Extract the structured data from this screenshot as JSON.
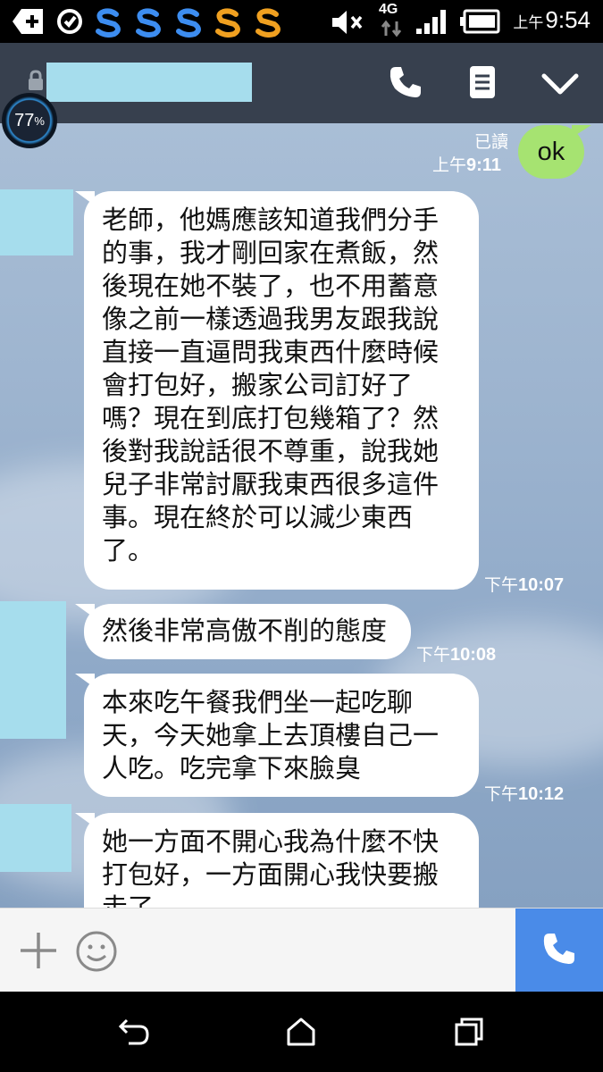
{
  "status_bar": {
    "time_period": "上午",
    "time": "9:54",
    "network_type": "4G",
    "icons": [
      "add-notification-icon",
      "sync-icon",
      "blue-s-app-icon",
      "orange-s-app-icon",
      "mute-icon",
      "signal-icon",
      "battery-icon"
    ]
  },
  "header": {
    "icons": [
      "lock-icon",
      "phone-icon",
      "notes-icon",
      "chevron-down-icon"
    ]
  },
  "battery_widget": {
    "value": "77",
    "unit": "%"
  },
  "sent": {
    "read_label": "已讀",
    "time_period": "上午",
    "time": "9:11",
    "text": "ok"
  },
  "messages": [
    {
      "text": "老師，他媽應該知道我們分手\n的事，我才剛回家在煮飯，然\n後現在她不裝了，也不用蓄意\n像之前一樣透過我男友跟我說\n直接一直逼問我東西什麼時候\n會打包好，搬家公司訂好了\n嗎？現在到底打包幾箱了？然\n後對我說話很不尊重，說我她\n兒子非常討厭我東西很多這件\n事。現在終於可以減少東西\n了。",
      "time_period": "下午",
      "time": "10:07"
    },
    {
      "text": "然後非常高傲不削的態度",
      "time_period": "下午",
      "time": "10:08"
    },
    {
      "text": "本來吃午餐我們坐一起吃聊\n天，今天她拿上去頂樓自己一\n人吃。吃完拿下來臉臭",
      "time_period": "下午",
      "time": "10:12"
    },
    {
      "text": "她一方面不開心我為什麼不快\n打包好，一方面開心我快要搬\n走了。",
      "time_period": "",
      "time": ""
    }
  ],
  "input_bar": {
    "icons": [
      "plus-icon",
      "emoji-icon",
      "phone-call-icon"
    ]
  },
  "nav_bar": {
    "icons": [
      "back-icon",
      "home-icon",
      "recent-apps-icon"
    ]
  },
  "colors": {
    "header_bg": "#37404e",
    "sent_bubble": "#a6e371",
    "received_bubble": "#ffffff",
    "call_button": "#4a8be8",
    "redaction": "#a6dded"
  }
}
